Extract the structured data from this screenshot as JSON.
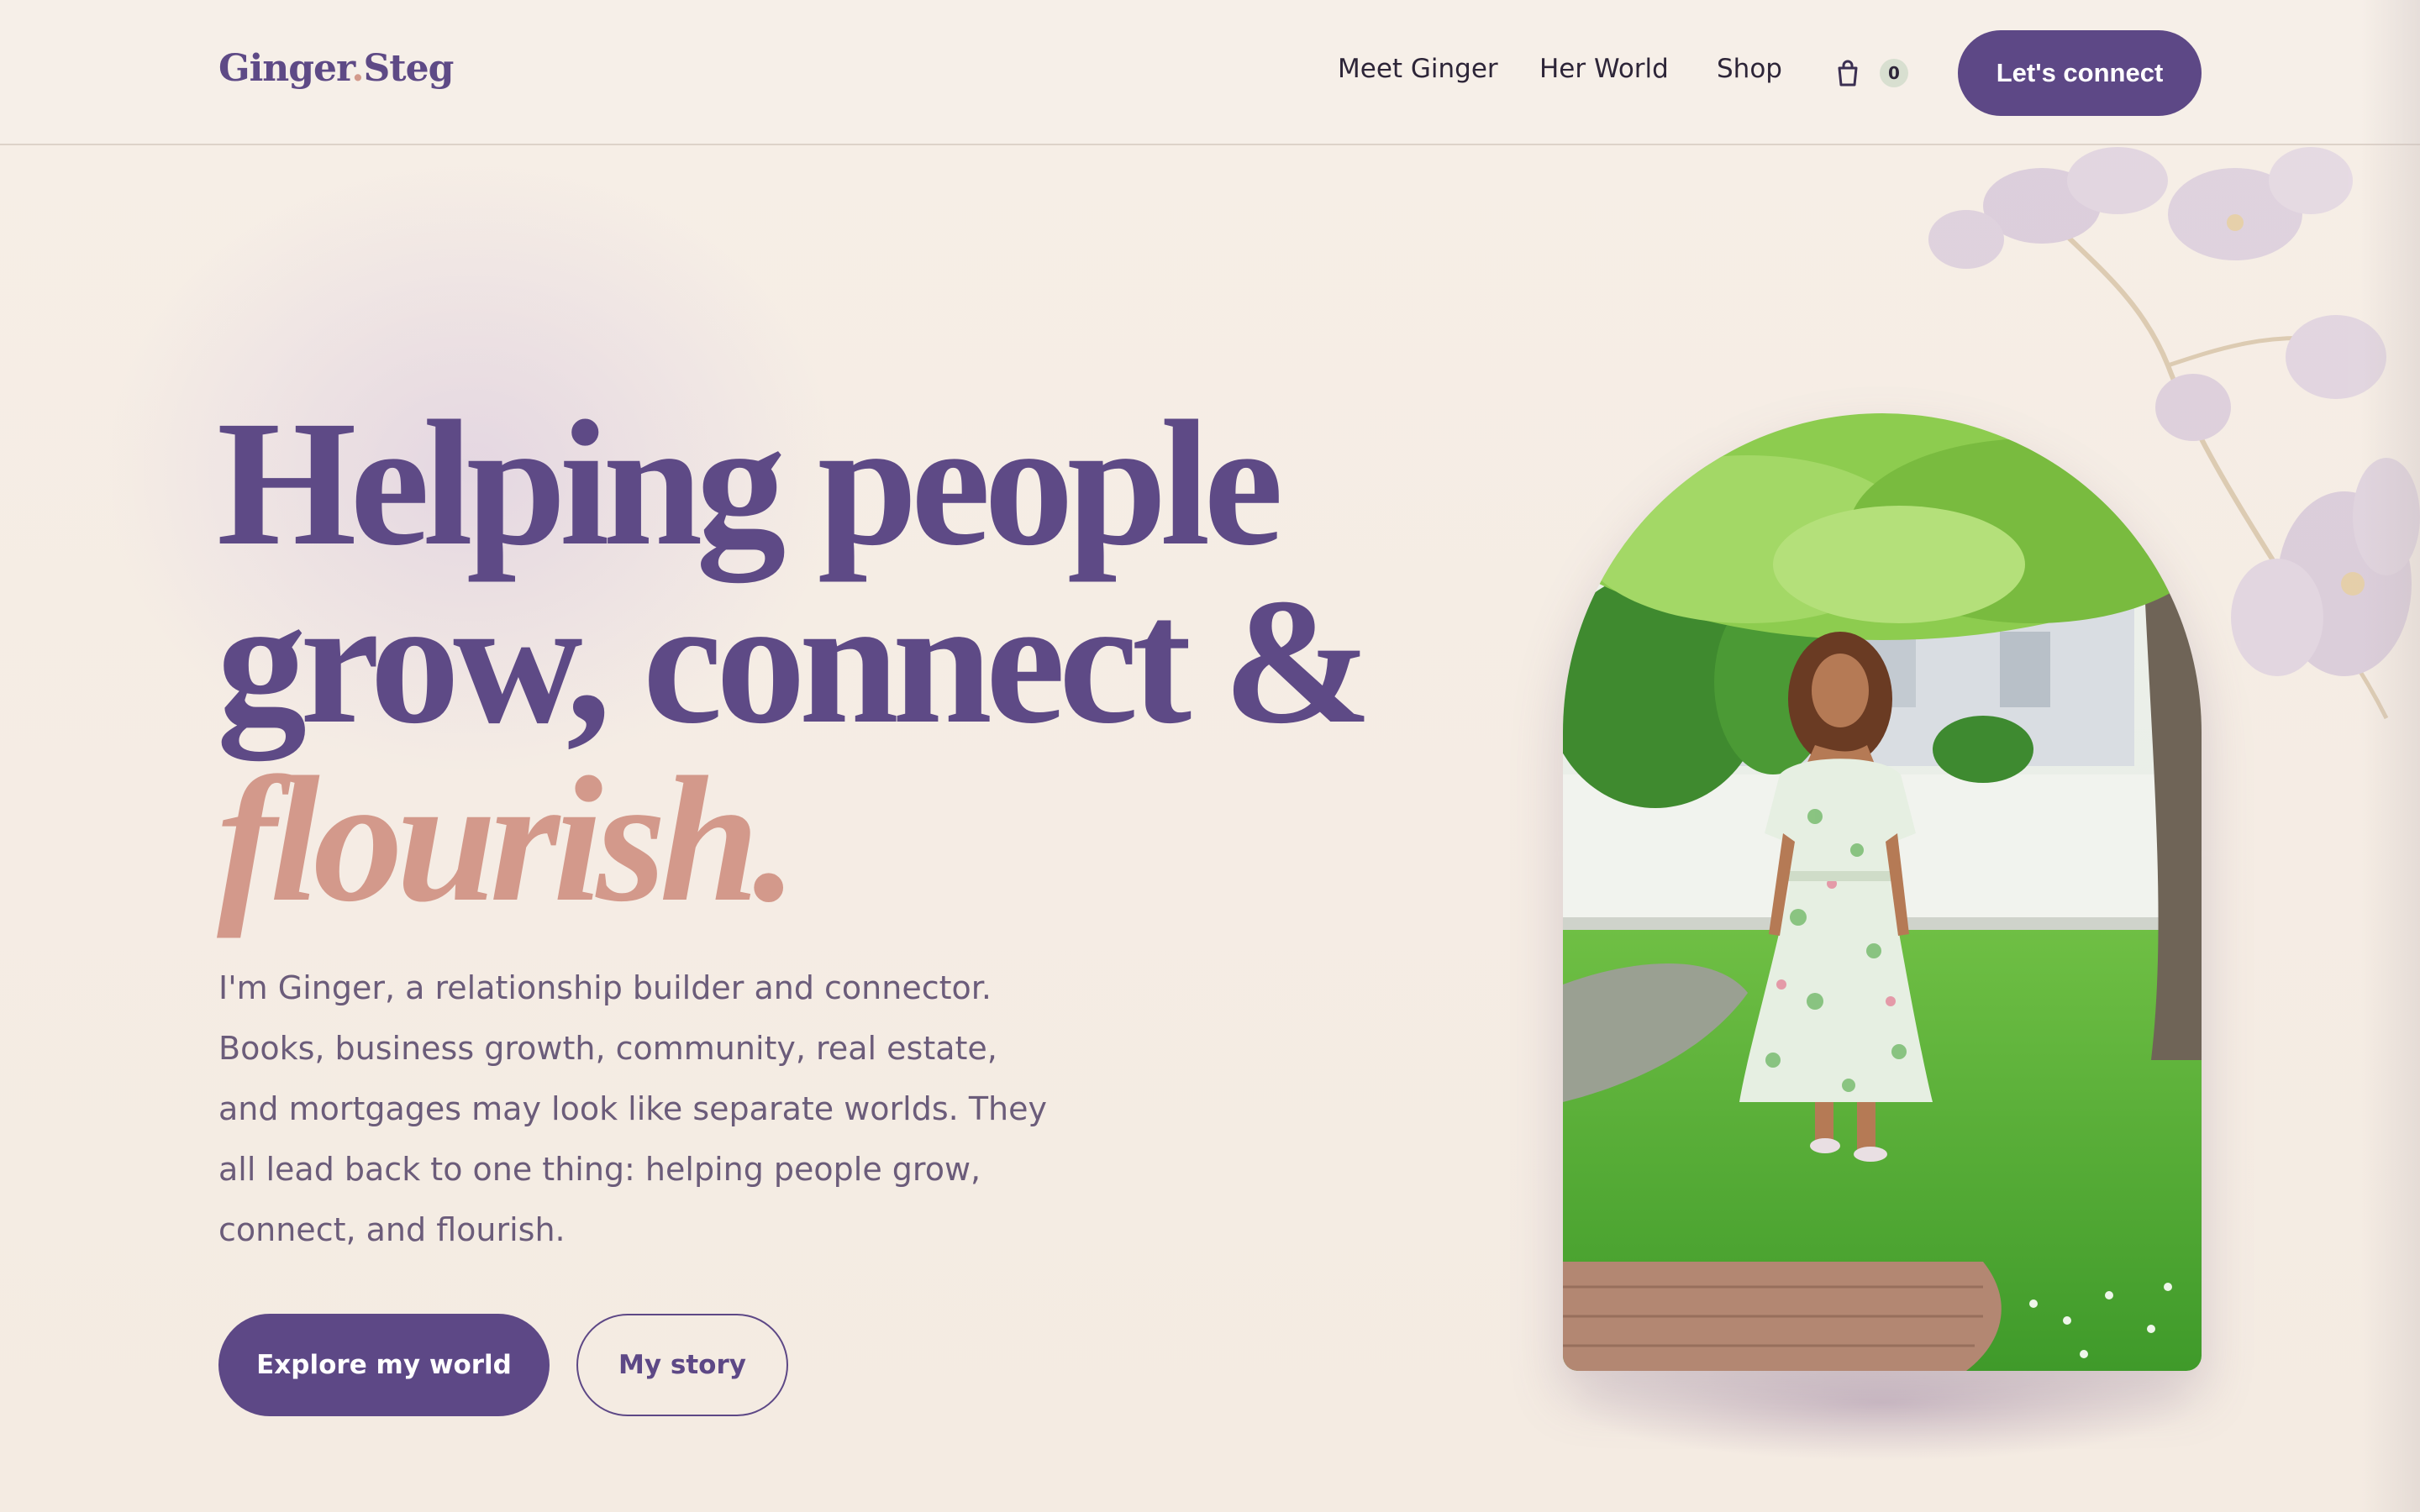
{
  "brand": {
    "logo_first": "Ginger",
    "logo_dot": ".",
    "logo_last": "Steg"
  },
  "nav": {
    "items": [
      "Meet Ginger",
      "Her World",
      "Shop"
    ],
    "cart_count": "0",
    "cta": "Let's connect"
  },
  "hero": {
    "headline_line1": "Helping people",
    "headline_line2": "grow, connect &",
    "headline_accent": "flourish.",
    "intro_lines": [
      "I'm Ginger, a relationship builder and connector.",
      "Books, business growth, community, real estate,",
      "and mortgages may look like separate worlds. They",
      "all lead back to one thing: helping people grow,",
      "connect, and flourish."
    ],
    "primary_button": "Explore my world",
    "secondary_button": "My story"
  },
  "colors": {
    "brand_purple": "#5d4886",
    "accent_rose": "#d3998b",
    "background": "#f5ede4"
  },
  "icons": {
    "cart": "shopping-bag-icon"
  }
}
